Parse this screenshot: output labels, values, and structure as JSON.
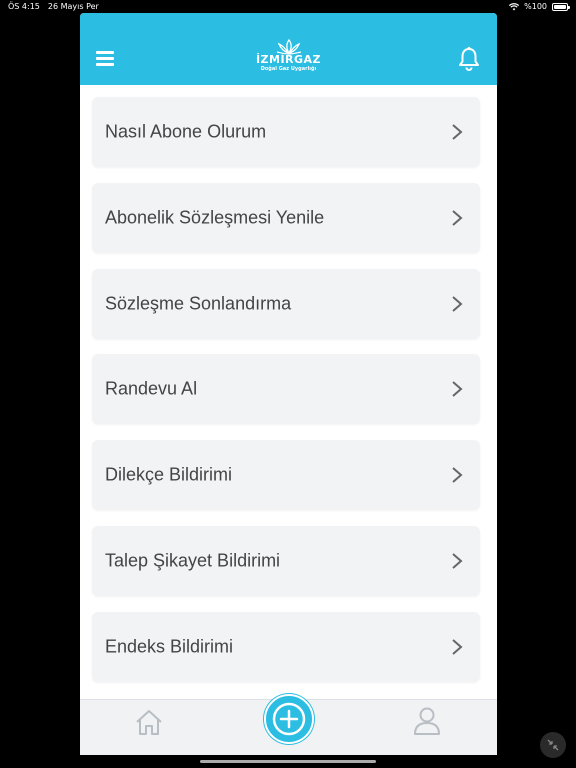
{
  "status_bar": {
    "time": "ÖS 4:15",
    "date": "26 Mayıs Per",
    "battery": "%100"
  },
  "header": {
    "logo_title": "İZMİRGAZ",
    "logo_subtitle": "Doğal Gaz Uygarlığı"
  },
  "menu": {
    "items": [
      {
        "label": "Nasıl Abone Olurum"
      },
      {
        "label": "Abonelik Sözleşmesi Yenile"
      },
      {
        "label": "Sözleşme Sonlandırma"
      },
      {
        "label": "Randevu Al"
      },
      {
        "label": "Dilekçe Bildirimi"
      },
      {
        "label": "Talep Şikayet Bildirimi"
      },
      {
        "label": "Endeks Bildirimi"
      }
    ]
  },
  "colors": {
    "brand": "#2bbde2",
    "item_bg": "#f2f3f5",
    "text": "#444444"
  },
  "icons": {
    "menu": "hamburger-icon",
    "notifications": "bell-icon",
    "item": "chevron-right-icon",
    "home": "home-icon",
    "add": "plus-circle-icon",
    "profile": "user-icon"
  }
}
